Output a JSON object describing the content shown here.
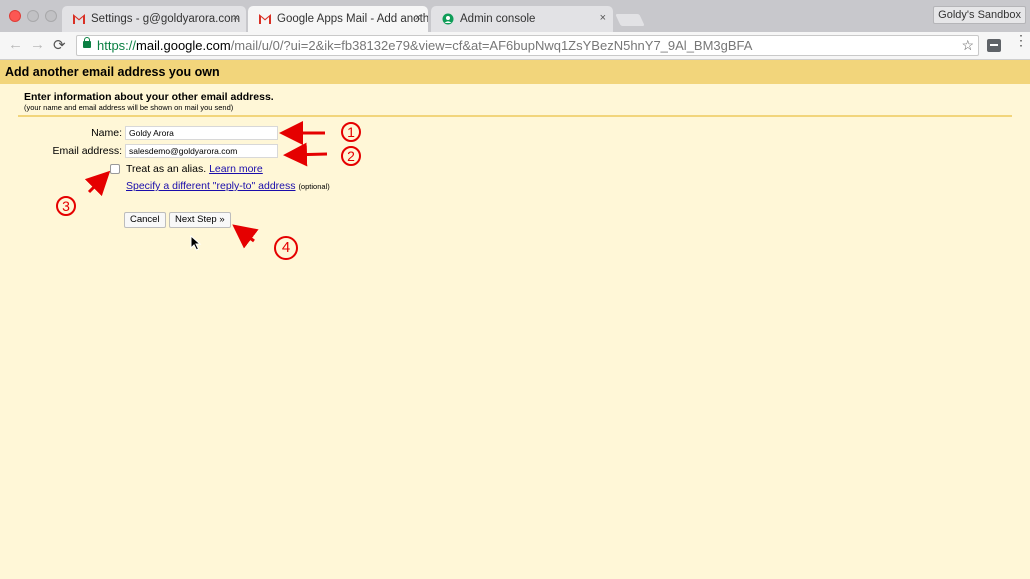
{
  "browser": {
    "tabs": [
      {
        "label": "Settings - g@goldyarora.com",
        "icon": "gmail-icon",
        "close": "×"
      },
      {
        "label": "Google Apps Mail - Add anoth",
        "icon": "gmail-icon",
        "close": "×"
      },
      {
        "label": "Admin console",
        "icon": "admin-console-icon",
        "close": "×"
      }
    ],
    "profile_label": "Goldy's Sandbox",
    "url_scheme": "https://",
    "url_host": "mail.google.com",
    "url_path": "/mail/u/0/?ui=2&ik=fb38132e79&view=cf&at=AF6bupNwq1ZsYBezN5hnY7_9Al_BM3gBFA",
    "nav_back": "←",
    "nav_forward": "→",
    "nav_reload": "⟳",
    "star": "☆",
    "menu": "⋮",
    "accent_red": "#fc5753"
  },
  "page": {
    "header": "Add another email address you own",
    "intro_title": "Enter information about your other email address.",
    "intro_sub": "(your name and email address will be shown on mail you send)",
    "name_label": "Name:",
    "name_value": "Goldy Arora",
    "email_label": "Email address:",
    "email_value": "salesdemo@goldyarora.com",
    "alias_text": "Treat as an alias.",
    "learn_more": "Learn more",
    "reply_to_link": "Specify a different \"reply-to\" address",
    "optional": "(optional)",
    "cancel_label": "Cancel",
    "next_label": "Next Step »",
    "background": "#fff7d7",
    "header_bg": "#f2d57b"
  },
  "annotations": {
    "steps": [
      "1",
      "2",
      "3",
      "4"
    ],
    "color": "#e50000"
  }
}
